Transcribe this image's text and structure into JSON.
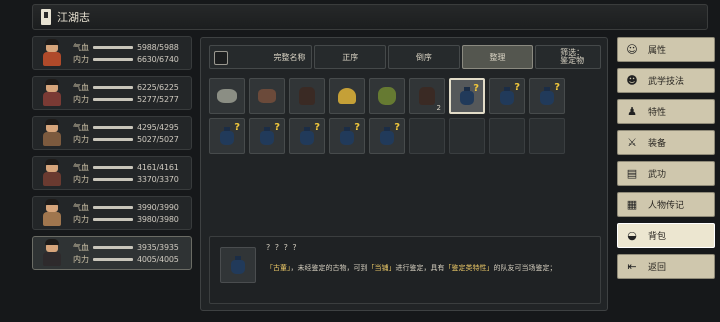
{
  "title": "江湖志",
  "characters": [
    {
      "hp_label": "气血",
      "hp": "5988/5988",
      "mp_label": "内力",
      "mp": "6630/6740",
      "color": "#b04a2a",
      "active": false
    },
    {
      "hp_label": "气血",
      "hp": "6225/6225",
      "mp_label": "内力",
      "mp": "5277/5277",
      "color": "#7a3a34",
      "active": false
    },
    {
      "hp_label": "气血",
      "hp": "4295/4295",
      "mp_label": "内力",
      "mp": "5027/5027",
      "color": "#7c5a3e",
      "active": false
    },
    {
      "hp_label": "气血",
      "hp": "4161/4161",
      "mp_label": "内力",
      "mp": "3370/3370",
      "color": "#6a3a30",
      "active": false
    },
    {
      "hp_label": "气血",
      "hp": "3990/3990",
      "mp_label": "内力",
      "mp": "3980/3980",
      "color": "#a0764e",
      "active": false
    },
    {
      "hp_label": "气血",
      "hp": "3935/3935",
      "mp_label": "内力",
      "mp": "4005/4005",
      "color": "#2e2a2c",
      "active": true
    }
  ],
  "sort": {
    "complete_name": "完整名称",
    "asc": "正序",
    "desc": "倒序",
    "organize": "整理",
    "filter_line1": "筛选：",
    "filter_line2": "鉴定物"
  },
  "inventory_row1": [
    {
      "kind": "graybug",
      "qty": "",
      "q": false,
      "selected": false
    },
    {
      "kind": "brownobj",
      "qty": "",
      "q": false,
      "selected": false
    },
    {
      "kind": "jar",
      "qty": "",
      "q": false,
      "selected": false
    },
    {
      "kind": "gold",
      "qty": "",
      "q": false,
      "selected": false
    },
    {
      "kind": "greenobj",
      "qty": "",
      "q": false,
      "selected": false
    },
    {
      "kind": "jar",
      "qty": "2",
      "q": false,
      "selected": false
    },
    {
      "kind": "vase",
      "qty": "",
      "q": true,
      "selected": true
    },
    {
      "kind": "vase",
      "qty": "",
      "q": true,
      "selected": false
    },
    {
      "kind": "vase",
      "qty": "",
      "q": true,
      "selected": false
    }
  ],
  "inventory_row2": [
    {
      "kind": "vase",
      "qty": "",
      "q": true,
      "selected": false
    },
    {
      "kind": "vase",
      "qty": "",
      "q": true,
      "selected": false
    },
    {
      "kind": "vase",
      "qty": "",
      "q": true,
      "selected": false
    },
    {
      "kind": "vase",
      "qty": "",
      "q": true,
      "selected": false
    },
    {
      "kind": "vase",
      "qty": "",
      "q": true,
      "selected": false
    },
    {
      "kind": "",
      "qty": "",
      "q": false,
      "selected": false
    },
    {
      "kind": "",
      "qty": "",
      "q": false,
      "selected": false
    },
    {
      "kind": "",
      "qty": "",
      "q": false,
      "selected": false
    },
    {
      "kind": "",
      "qty": "",
      "q": false,
      "selected": false
    }
  ],
  "question_mark": "?",
  "description": {
    "title": "? ? ? ?",
    "hl1": "「古董」",
    "t1": "，未经鉴定的古物，可到",
    "hl2": "「当铺」",
    "t2": "进行鉴定，具有",
    "hl3": "「鉴定类特性」",
    "t3": "的队友可当场鉴定；"
  },
  "menu": [
    {
      "label": "属性",
      "icon": "☺",
      "icon_name": "person-icon",
      "active": false
    },
    {
      "label": "武学技法",
      "icon": "☻",
      "icon_name": "martial-icon",
      "active": false
    },
    {
      "label": "特性",
      "icon": "♟",
      "icon_name": "trait-icon",
      "active": false
    },
    {
      "label": "装备",
      "icon": "⚔",
      "icon_name": "equipment-icon",
      "active": false
    },
    {
      "label": "武功",
      "icon": "▤",
      "icon_name": "kungfu-icon",
      "active": false
    },
    {
      "label": "人物传记",
      "icon": "▦",
      "icon_name": "biography-icon",
      "active": false
    },
    {
      "label": "背包",
      "icon": "◒",
      "icon_name": "backpack-icon",
      "active": true
    },
    {
      "label": "返回",
      "icon": "⇤",
      "icon_name": "return-icon",
      "active": false
    }
  ]
}
